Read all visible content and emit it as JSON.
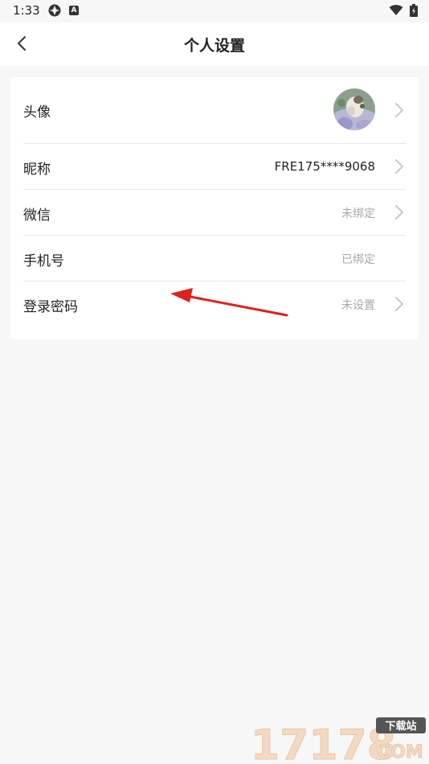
{
  "status_bar": {
    "time": "1:33",
    "icons": [
      "aperture-icon",
      "a-badge-icon",
      "wifi-icon",
      "battery-charging-icon"
    ]
  },
  "nav": {
    "title": "个人设置",
    "back_icon": "chevron-left-icon"
  },
  "settings": {
    "avatar": {
      "label": "头像"
    },
    "nickname": {
      "label": "昵称",
      "value": "FRE175****9068"
    },
    "wechat": {
      "label": "微信",
      "value": "未绑定"
    },
    "phone": {
      "label": "手机号",
      "value": "已绑定"
    },
    "password": {
      "label": "登录密码",
      "value": "未设置"
    }
  },
  "annotation": {
    "color": "#e02020"
  },
  "watermark": {
    "number": "17178",
    "site": "下载站",
    "domain": "COM"
  },
  "colors": {
    "background": "#f7f7f7",
    "card": "#ffffff",
    "muted_text": "#a8a8a8",
    "chevron": "#c8c8c8"
  }
}
